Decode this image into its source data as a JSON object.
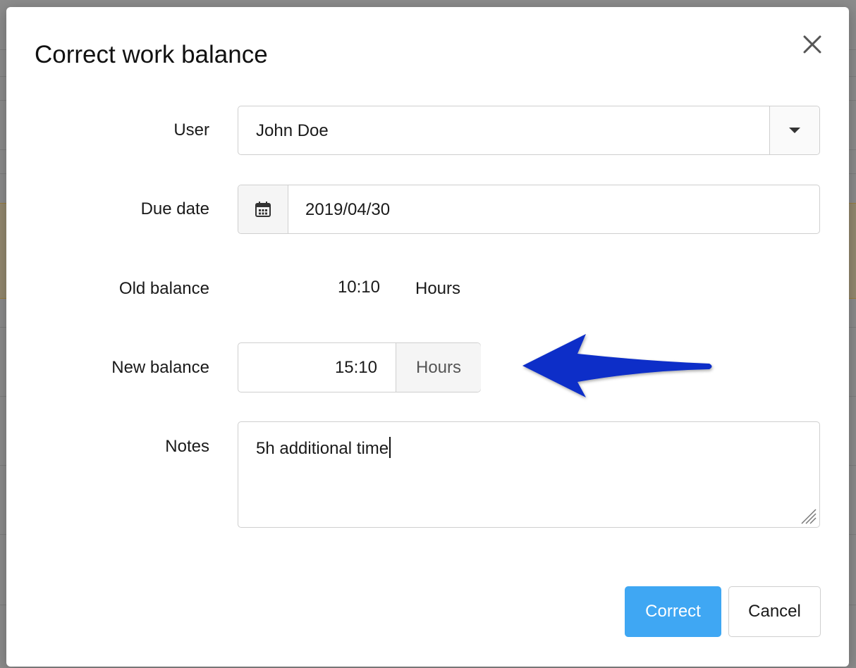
{
  "dialog": {
    "title": "Correct work balance",
    "close_icon": "close-icon"
  },
  "form": {
    "user": {
      "label": "User",
      "value": "John Doe",
      "icon": "chevron-down-icon"
    },
    "due_date": {
      "label": "Due date",
      "value": "2019/04/30",
      "icon": "calendar-icon"
    },
    "old_balance": {
      "label": "Old balance",
      "value": "10:10",
      "unit": "Hours"
    },
    "new_balance": {
      "label": "New balance",
      "value": "15:10",
      "unit": "Hours"
    },
    "notes": {
      "label": "Notes",
      "value": "5h additional time"
    }
  },
  "buttons": {
    "correct": "Correct",
    "cancel": "Cancel"
  },
  "annotation": {
    "icon": "arrow-left-icon",
    "color": "#0a2dc8"
  },
  "colors": {
    "primary": "#3fa7f3"
  }
}
